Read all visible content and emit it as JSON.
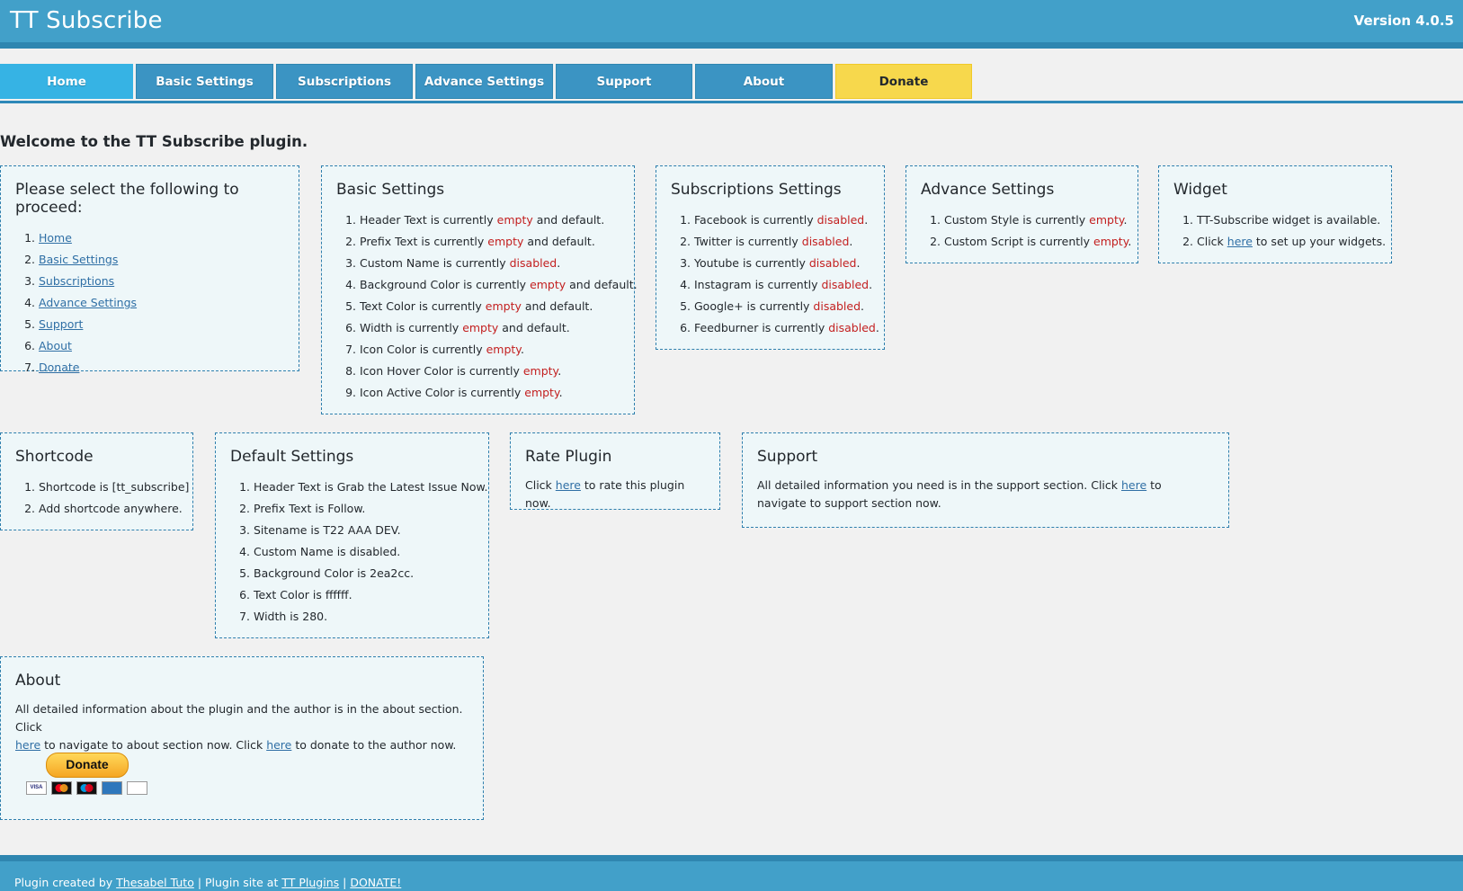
{
  "header": {
    "title": "TT Subscribe",
    "version": "Version 4.0.5"
  },
  "tabs": [
    "Home",
    "Basic Settings",
    "Subscriptions",
    "Advance Settings",
    "Support",
    "About",
    "Donate"
  ],
  "welcome": "Welcome to the TT Subscribe plugin.",
  "proceed": {
    "title": "Please select the following to proceed:",
    "links": [
      "Home",
      "Basic Settings",
      "Subscriptions",
      "Advance Settings",
      "Support",
      "About",
      "Donate"
    ]
  },
  "basic": {
    "title": "Basic Settings",
    "items": [
      {
        "pre": "Header Text is currently ",
        "status": "empty",
        "post": " and default."
      },
      {
        "pre": "Prefix Text is currently ",
        "status": "empty",
        "post": " and default."
      },
      {
        "pre": "Custom Name is currently ",
        "status": "disabled",
        "post": "."
      },
      {
        "pre": "Background Color is currently ",
        "status": "empty",
        "post": " and default."
      },
      {
        "pre": "Text Color is currently ",
        "status": "empty",
        "post": " and default."
      },
      {
        "pre": "Width is currently ",
        "status": "empty",
        "post": " and default."
      },
      {
        "pre": "Icon Color is currently ",
        "status": "empty",
        "post": "."
      },
      {
        "pre": "Icon Hover Color is currently ",
        "status": "empty",
        "post": "."
      },
      {
        "pre": "Icon Active Color is currently ",
        "status": "empty",
        "post": "."
      }
    ]
  },
  "subscriptions": {
    "title": "Subscriptions Settings",
    "items": [
      {
        "pre": "Facebook is currently ",
        "status": "disabled",
        "post": "."
      },
      {
        "pre": "Twitter is currently ",
        "status": "disabled",
        "post": "."
      },
      {
        "pre": "Youtube is currently ",
        "status": "disabled",
        "post": "."
      },
      {
        "pre": "Instagram is currently ",
        "status": "disabled",
        "post": "."
      },
      {
        "pre": "Google+ is currently ",
        "status": "disabled",
        "post": "."
      },
      {
        "pre": "Feedburner is currently ",
        "status": "disabled",
        "post": "."
      }
    ]
  },
  "advance": {
    "title": "Advance Settings",
    "items": [
      {
        "pre": "Custom Style is currently ",
        "status": "empty",
        "post": "."
      },
      {
        "pre": "Custom Script is currently ",
        "status": "empty",
        "post": "."
      }
    ]
  },
  "widget": {
    "title": "Widget",
    "item1": "TT-Subscribe widget is available.",
    "item2_pre": "Click ",
    "item2_link": "here",
    "item2_post": " to set up your widgets."
  },
  "shortcode": {
    "title": "Shortcode",
    "items": [
      "Shortcode is [tt_subscribe]",
      "Add shortcode anywhere."
    ]
  },
  "defaults": {
    "title": "Default Settings",
    "items": [
      "Header Text is Grab the Latest Issue Now.",
      "Prefix Text is Follow.",
      "Sitename is T22 AAA DEV.",
      "Custom Name is disabled.",
      "Background Color is 2ea2cc.",
      "Text Color is ffffff.",
      "Width is 280."
    ]
  },
  "rate": {
    "title": "Rate Plugin",
    "pre": "Click ",
    "link": "here",
    "post": " to rate this plugin now."
  },
  "support": {
    "title": "Support",
    "pre": "All detailed information you need is in the support section. Click ",
    "link": "here",
    "post": " to navigate to support section now."
  },
  "about": {
    "title": "About",
    "line1": "All detailed information about the plugin and the author is in the about section. Click",
    "link1": "here",
    "mid": " to navigate to about section now. Click ",
    "link2": "here",
    "post": " to donate to the author now.",
    "donate_button": "Donate",
    "cards": [
      "VISA",
      "MC",
      "MAESTRO",
      "AMEX",
      "DISCOVER"
    ]
  },
  "footer": {
    "pre": "Plugin created by ",
    "author": "Thesabel Tuto",
    "mid": " | Plugin site at ",
    "site": "TT Plugins",
    "sep": " | ",
    "donate": "DONATE!"
  },
  "colors": {
    "header": "#42a0c9",
    "tab": "#3b94c3",
    "tab_active": "#36b3e4",
    "donate_tab": "#f7d84c",
    "status_red": "#c32020",
    "box_bg": "#eef7f9"
  }
}
